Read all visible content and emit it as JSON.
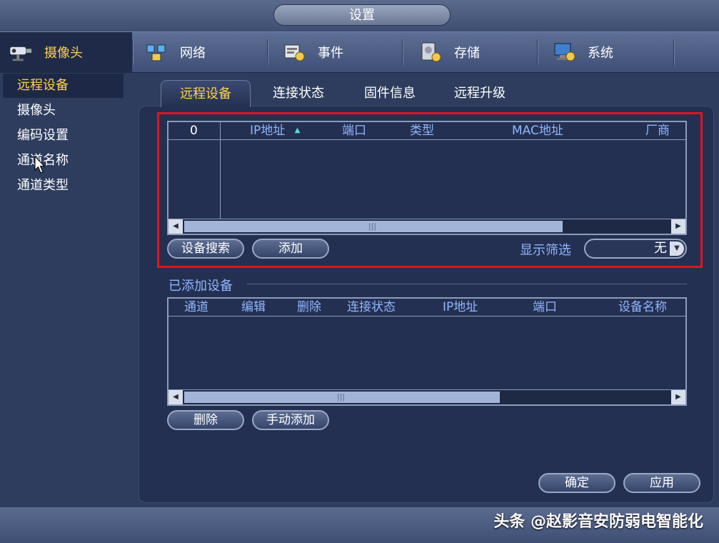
{
  "window": {
    "title": "设置"
  },
  "topnav": {
    "items": [
      {
        "label": "摄像头",
        "icon": "camera-icon",
        "active": true
      },
      {
        "label": "网络",
        "icon": "network-icon",
        "active": false
      },
      {
        "label": "事件",
        "icon": "event-icon",
        "active": false
      },
      {
        "label": "存储",
        "icon": "storage-icon",
        "active": false
      },
      {
        "label": "系统",
        "icon": "system-icon",
        "active": false
      }
    ]
  },
  "sidebar": {
    "items": [
      {
        "label": "远程设备",
        "active": true
      },
      {
        "label": "摄像头",
        "active": false
      },
      {
        "label": "编码设置",
        "active": false
      },
      {
        "label": "通道名称",
        "active": false
      },
      {
        "label": "通道类型",
        "active": false
      }
    ]
  },
  "subtabs": [
    {
      "label": "远程设备",
      "active": true
    },
    {
      "label": "连接状态",
      "active": false
    },
    {
      "label": "固件信息",
      "active": false
    },
    {
      "label": "远程升级",
      "active": false
    }
  ],
  "search_table": {
    "columns": [
      "0",
      "IP地址",
      "端口",
      "类型",
      "MAC地址",
      "厂商"
    ],
    "sort_indicator": "▲",
    "rows": []
  },
  "search_actions": {
    "search_label": "设备搜索",
    "add_label": "添加",
    "filter_label": "显示筛选",
    "filter_value": "无"
  },
  "added_section": {
    "title": "已添加设备",
    "columns": [
      "通道",
      "编辑",
      "删除",
      "连接状态",
      "IP地址",
      "端口",
      "设备名称"
    ],
    "rows": [],
    "delete_label": "删除",
    "manual_add_label": "手动添加"
  },
  "footer": {
    "ok_label": "确定",
    "apply_label": "应用"
  },
  "watermark": "头条 @赵影音安防弱电智能化",
  "colors": {
    "accent": "#ffd24a",
    "header_text": "#8fb6ff",
    "highlight_border": "#e0141e"
  }
}
